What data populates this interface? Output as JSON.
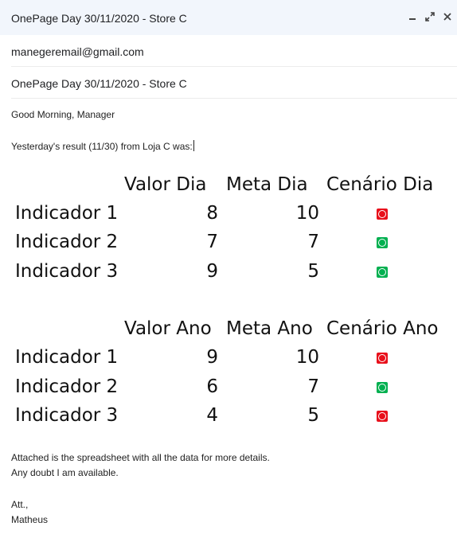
{
  "window": {
    "title": "OnePage Day 30/11/2020 - Store C"
  },
  "email": {
    "to": "manegeremail@gmail.com",
    "subject": "OnePage Day 30/11/2020 - Store C",
    "greeting": "Good Morning, Manager",
    "intro": "Yesterday's result (11/30) from Loja C was:",
    "attached": "Attached is the spreadsheet with all the data for more details.",
    "doubt": "Any doubt I am available.",
    "sign_att": "Att.,",
    "sign_name": "Matheus"
  },
  "colors": {
    "red": "#e8101b",
    "green": "#00b050"
  },
  "tables": [
    {
      "headers": [
        "Valor Dia",
        "Meta Dia",
        "Cenário Dia"
      ],
      "rows": [
        {
          "label": "Indicador 1",
          "value": "8",
          "target": "10",
          "status": "red"
        },
        {
          "label": "Indicador 2",
          "value": "7",
          "target": "7",
          "status": "green"
        },
        {
          "label": "Indicador 3",
          "value": "9",
          "target": "5",
          "status": "green"
        }
      ]
    },
    {
      "headers": [
        "Valor Ano",
        "Meta Ano",
        "Cenário Ano"
      ],
      "rows": [
        {
          "label": "Indicador 1",
          "value": "9",
          "target": "10",
          "status": "red"
        },
        {
          "label": "Indicador 2",
          "value": "6",
          "target": "7",
          "status": "green"
        },
        {
          "label": "Indicador 3",
          "value": "4",
          "target": "5",
          "status": "red"
        }
      ]
    }
  ]
}
